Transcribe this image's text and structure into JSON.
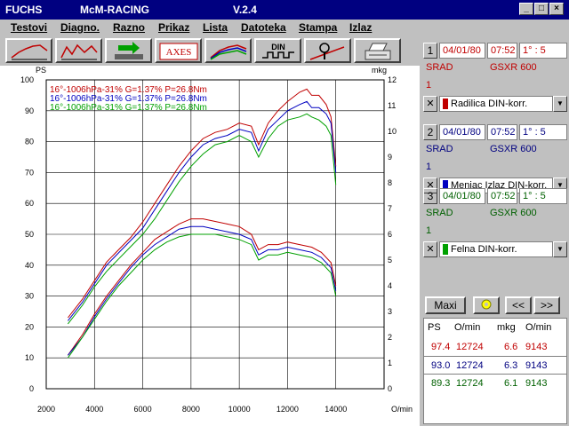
{
  "window": {
    "app": "FUCHS",
    "name": "McM-RACING",
    "version": "V.2.4",
    "controls": [
      "_",
      "□",
      "×"
    ]
  },
  "menu": [
    "Testovi",
    "Diagno.",
    "Razno",
    "Prikaz",
    "Lista",
    "Datoteka",
    "Stampa",
    "Izlaz"
  ],
  "toolbar": {
    "axes_label": "AXES",
    "din_label": "DIN",
    "colors": {
      "red": "#c00000",
      "green": "#00a000",
      "gray": "#606060"
    }
  },
  "chart_data": {
    "type": "line",
    "left_axis_label": "PS",
    "right_axis_label": "mkg",
    "x_axis_label": "O/min",
    "xlim": [
      2000,
      16000
    ],
    "ylim": [
      0,
      100
    ],
    "ylim_right": [
      0,
      12
    ],
    "x_ticks": [
      2000,
      4000,
      6000,
      8000,
      10000,
      12000,
      14000
    ],
    "y_ticks": [
      0,
      10,
      20,
      30,
      40,
      50,
      60,
      70,
      80,
      90,
      100
    ],
    "y_ticks_right": [
      0,
      1,
      2,
      3,
      4,
      5,
      6,
      7,
      8,
      9,
      10,
      11,
      12
    ],
    "grid": true,
    "legend": [
      {
        "text": "16°-1006hPa-31% G=1.37% P=26.8Nm",
        "color": "#c00000"
      },
      {
        "text": "16°-1006hPa-31% G=1.37% P=26.8Nm",
        "color": "#0000c0"
      },
      {
        "text": "16°-1006hPa-31% G=1.37% P=26.8Nm",
        "color": "#00a000"
      }
    ],
    "series": [
      {
        "kind": "power",
        "color": "#c00000",
        "x": [
          2900,
          3500,
          4000,
          4500,
          5000,
          5500,
          6000,
          6500,
          7000,
          7500,
          8000,
          8500,
          9000,
          9500,
          10000,
          10500,
          10800,
          11200,
          11600,
          12000,
          12500,
          12800,
          13000,
          13300,
          13600,
          13800,
          14000
        ],
        "y": [
          23,
          29,
          35,
          41,
          45,
          49,
          54,
          60,
          66,
          72,
          77,
          81,
          83,
          84,
          86,
          85,
          79,
          86,
          90,
          93,
          96,
          97,
          95,
          95,
          92,
          88,
          72
        ]
      },
      {
        "kind": "power",
        "color": "#0000c0",
        "x": [
          2900,
          3500,
          4000,
          4500,
          5000,
          5500,
          6000,
          6500,
          7000,
          7500,
          8000,
          8500,
          9000,
          9500,
          10000,
          10500,
          10800,
          11200,
          11600,
          12000,
          12500,
          12800,
          13000,
          13300,
          13600,
          13800,
          14000
        ],
        "y": [
          22,
          28,
          34,
          40,
          44,
          48,
          52,
          58,
          64,
          70,
          75,
          79,
          81,
          82,
          84,
          83,
          77,
          84,
          87,
          90,
          92,
          93,
          91,
          91,
          89,
          86,
          70
        ]
      },
      {
        "kind": "power",
        "color": "#00a000",
        "x": [
          2900,
          3500,
          4000,
          4500,
          5000,
          5500,
          6000,
          6500,
          7000,
          7500,
          8000,
          8500,
          9000,
          9500,
          10000,
          10500,
          10800,
          11200,
          11600,
          12000,
          12500,
          12800,
          13000,
          13300,
          13600,
          13800,
          14000
        ],
        "y": [
          21,
          27,
          33,
          38,
          42,
          46,
          50,
          55,
          61,
          67,
          72,
          76,
          79,
          80,
          82,
          80,
          75,
          81,
          85,
          87,
          88,
          89,
          88,
          87,
          85,
          82,
          66
        ]
      },
      {
        "kind": "torque",
        "color": "#c00000",
        "x": [
          2900,
          3500,
          4000,
          4500,
          5000,
          5500,
          6000,
          6500,
          7000,
          7500,
          8000,
          8500,
          9000,
          9500,
          10000,
          10500,
          10800,
          11200,
          11600,
          12000,
          12500,
          13000,
          13400,
          13800,
          14000
        ],
        "y": [
          1.3,
          2.1,
          2.9,
          3.6,
          4.2,
          4.8,
          5.3,
          5.8,
          6.1,
          6.4,
          6.6,
          6.6,
          6.5,
          6.4,
          6.3,
          6.0,
          5.4,
          5.6,
          5.6,
          5.7,
          5.6,
          5.5,
          5.3,
          4.9,
          4.0
        ]
      },
      {
        "kind": "torque",
        "color": "#0000c0",
        "x": [
          2900,
          3500,
          4000,
          4500,
          5000,
          5500,
          6000,
          6500,
          7000,
          7500,
          8000,
          8500,
          9000,
          9500,
          10000,
          10500,
          10800,
          11200,
          11600,
          12000,
          12500,
          13000,
          13400,
          13800,
          14000
        ],
        "y": [
          1.3,
          2.0,
          2.8,
          3.5,
          4.1,
          4.7,
          5.2,
          5.6,
          5.9,
          6.2,
          6.3,
          6.3,
          6.2,
          6.1,
          6.0,
          5.8,
          5.2,
          5.4,
          5.4,
          5.5,
          5.4,
          5.3,
          5.1,
          4.7,
          3.8
        ]
      },
      {
        "kind": "torque",
        "color": "#00a000",
        "x": [
          2900,
          3500,
          4000,
          4500,
          5000,
          5500,
          6000,
          6500,
          7000,
          7500,
          8000,
          8500,
          9000,
          9500,
          10000,
          10500,
          10800,
          11200,
          11600,
          12000,
          12500,
          13000,
          13400,
          13800,
          14000
        ],
        "y": [
          1.2,
          2.0,
          2.7,
          3.4,
          4.0,
          4.5,
          5.0,
          5.4,
          5.7,
          5.9,
          6.0,
          6.0,
          6.0,
          5.9,
          5.8,
          5.6,
          5.0,
          5.2,
          5.2,
          5.3,
          5.2,
          5.1,
          4.9,
          4.5,
          3.6
        ]
      }
    ]
  },
  "runs": [
    {
      "num": "1",
      "date": "04/01/80",
      "time": "07:52",
      "angle": "1° : 5",
      "mode": "SRAD",
      "bike": "GSXR 600",
      "gear": "1",
      "correction": "Radilica DIN-korr.",
      "color": "#c00000",
      "cls": "red"
    },
    {
      "num": "2",
      "date": "04/01/80",
      "time": "07:52",
      "angle": "1° : 5",
      "mode": "SRAD",
      "bike": "GSXR 600",
      "gear": "1",
      "correction": "Menjac Izlaz DIN-korr.",
      "color": "#0000c0",
      "cls": "blue"
    },
    {
      "num": "3",
      "date": "04/01/80",
      "time": "07:52",
      "angle": "1° : 5",
      "mode": "SRAD",
      "bike": "GSXR 600",
      "gear": "1",
      "correction": "Felna DIN-korr.",
      "color": "#00a000",
      "cls": "green"
    }
  ],
  "panel_buttons": {
    "maxi": "Maxi",
    "zoom_icon": "key-icon",
    "prev": "<<",
    "next": ">>"
  },
  "results": {
    "headers": [
      "PS",
      "O/min",
      "mkg",
      "O/min"
    ],
    "rows": [
      {
        "ps": "97.4",
        "ps_rpm": "12724",
        "mkg": "6.6",
        "mkg_rpm": "9143",
        "color": "#c00000"
      },
      {
        "ps": "93.0",
        "ps_rpm": "12724",
        "mkg": "6.3",
        "mkg_rpm": "9143",
        "color": "#000080"
      },
      {
        "ps": "89.3",
        "ps_rpm": "12724",
        "mkg": "6.1",
        "mkg_rpm": "9143",
        "color": "#006000"
      }
    ]
  }
}
